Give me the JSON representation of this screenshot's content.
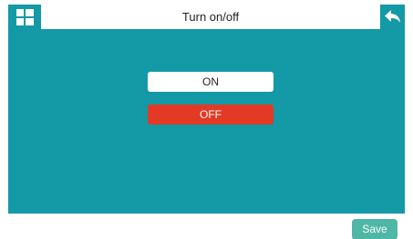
{
  "header": {
    "title": "Turn on/off",
    "menu_icon": "grid-icon",
    "back_icon": "back-arrow-icon"
  },
  "options": {
    "on_label": "ON",
    "off_label": "OFF",
    "selected": "OFF"
  },
  "footer": {
    "save_label": "Save"
  },
  "colors": {
    "accent": "#1499a6",
    "selected": "#e33a26",
    "save": "#4fb7a5"
  }
}
